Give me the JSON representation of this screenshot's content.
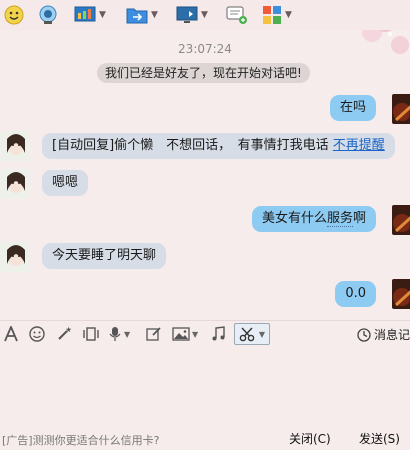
{
  "toolbar": {
    "items": [
      "user-icon",
      "camera-icon",
      "screen-share-icon",
      "file-transfer-icon",
      "remote-desktop-icon",
      "message-icon",
      "apps-icon"
    ]
  },
  "chat": {
    "timestamp": "23:07:24",
    "system_message": "我们已经是好友了，现在开始对话吧!",
    "messages": [
      {
        "side": "right",
        "text": "在吗"
      },
      {
        "side": "left",
        "prefix": "[自动回复]偷个懒　不想回话，　有事情打我电话",
        "link": "不再提醒"
      },
      {
        "side": "left",
        "text": "嗯嗯"
      },
      {
        "side": "right",
        "text_a": "美女有什么",
        "text_b": "服务",
        "text_c": "啊"
      },
      {
        "side": "left",
        "text": "今天要睡了明天聊"
      },
      {
        "side": "right",
        "text": "0.0"
      }
    ]
  },
  "input_toolbar": {
    "history_label": "消息记"
  },
  "footer": {
    "ad_text": "[广告]测测你更适合什么信用卡?",
    "close_label": "关闭(C)",
    "send_label": "发送(S)"
  },
  "colors": {
    "background": "#f7ecec",
    "outgoing_bubble": "#8ecbf2",
    "incoming_bubble": "#d6dde6",
    "link": "#1a63c7"
  }
}
